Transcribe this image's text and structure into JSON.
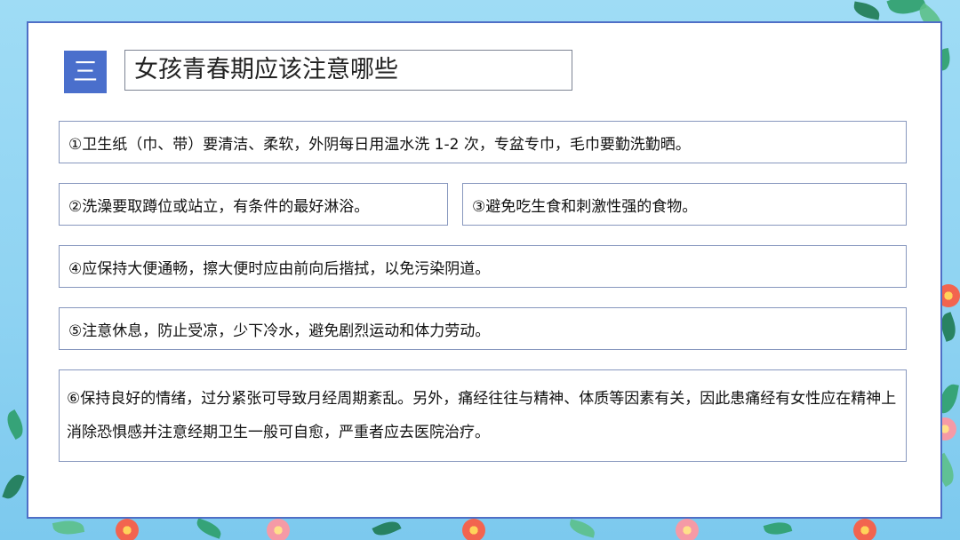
{
  "slide": {
    "section_number": "三",
    "title": "女孩青春期应该注意哪些",
    "items": [
      "①卫生纸（巾、带）要清洁、柔软，外阴每日用温水洗 1-2 次，专盆专巾，毛巾要勤洗勤晒。",
      "②洗澡要取蹲位或站立，有条件的最好淋浴。",
      "③避免吃生食和刺激性强的食物。",
      "④应保持大便通畅，擦大便时应由前向后揩拭，以免污染阴道。",
      "⑤注意休息，防止受凉，少下冷水，避免剧烈运动和体力劳动。",
      "⑥保持良好的情绪，过分紧张可导致月经周期紊乱。另外，痛经往往与精神、体质等因素有关，因此患痛经有女性应在精神上消除恐惧感并注意经期卫生一般可自愈，严重者应去医院治疗。"
    ]
  },
  "colors": {
    "accent": "#4a6fcc",
    "card_border": "#4f6fc6",
    "item_border": "#8797be",
    "background": "#8fd3f2"
  }
}
